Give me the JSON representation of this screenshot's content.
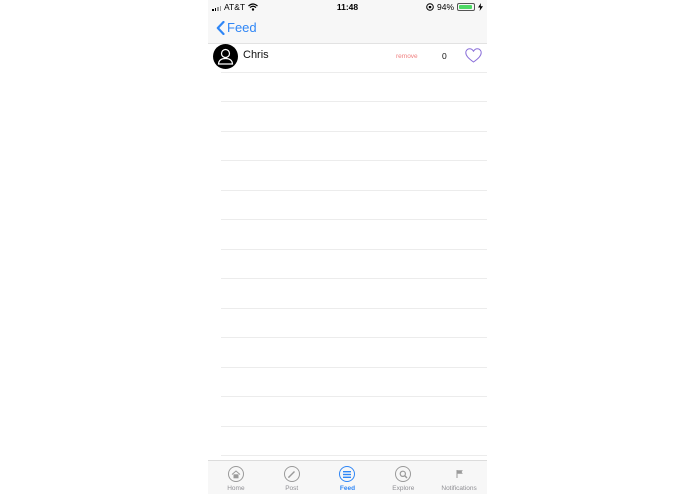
{
  "status_bar": {
    "carrier": "AT&T",
    "time": "11:48",
    "battery": "94%",
    "battery_level": 0.94
  },
  "nav": {
    "back_label": "Feed"
  },
  "rows": [
    {
      "name": "Chris",
      "remove_label": "remove",
      "count": "0"
    }
  ],
  "tabs": [
    {
      "label": "Home",
      "icon": "home-icon"
    },
    {
      "label": "Post",
      "icon": "pencil-icon"
    },
    {
      "label": "Feed",
      "icon": "list-icon",
      "active": true
    },
    {
      "label": "Explore",
      "icon": "search-icon"
    },
    {
      "label": "Notifications",
      "icon": "flag-icon"
    }
  ],
  "colors": {
    "accent": "#2f86f6",
    "remove": "#f08080",
    "heart": "#8a6fd9",
    "battery": "#4cd964"
  }
}
